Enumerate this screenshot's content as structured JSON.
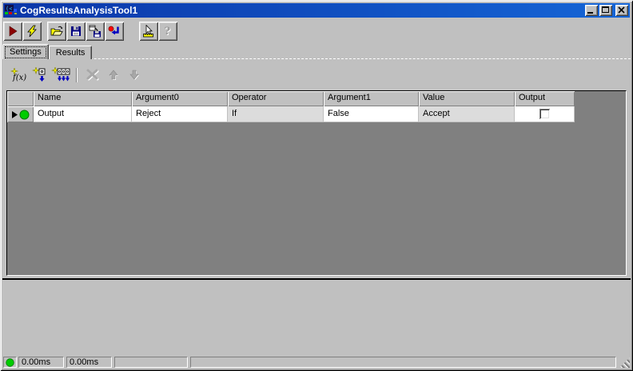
{
  "titlebar": {
    "title": "CogResultsAnalysisTool1",
    "icon": "cognex-tool-icon",
    "buttons": [
      {
        "name": "minimize",
        "icon": "minimize-icon"
      },
      {
        "name": "maximize",
        "icon": "maximize-icon"
      },
      {
        "name": "close",
        "icon": "close-icon"
      }
    ]
  },
  "main_toolbar": {
    "buttons": [
      {
        "name": "run",
        "icon": "run-icon"
      },
      {
        "name": "trigger",
        "icon": "lightning-icon"
      },
      {
        "name": "open",
        "icon": "open-folder-icon"
      },
      {
        "name": "save",
        "icon": "floppy-icon"
      },
      {
        "name": "save-as",
        "icon": "save-as-icon"
      },
      {
        "name": "reset",
        "icon": "reset-icon"
      },
      {
        "name": "pointer-tool",
        "icon": "pointer-ruler-icon"
      },
      {
        "name": "help",
        "icon": "help-icon",
        "disabled": true
      }
    ]
  },
  "tabs": [
    {
      "label": "Settings",
      "active": true
    },
    {
      "label": "Results",
      "active": false
    }
  ],
  "grid_toolbar": {
    "buttons": [
      {
        "name": "add-function",
        "icon": "add-function-icon",
        "text": "f(x)"
      },
      {
        "name": "add-input",
        "icon": "add-input-icon"
      },
      {
        "name": "add-all-inputs",
        "icon": "add-all-inputs-icon"
      },
      {
        "name": "delete",
        "icon": "delete-x-icon",
        "disabled": true
      },
      {
        "name": "move-up",
        "icon": "up-arrow-icon",
        "disabled": true
      },
      {
        "name": "move-down",
        "icon": "down-arrow-icon",
        "disabled": true
      }
    ]
  },
  "grid": {
    "columns": [
      "Name",
      "Argument0",
      "Operator",
      "Argument1",
      "Value",
      "Output"
    ],
    "rows": [
      {
        "name": "Output",
        "argument0": "Reject",
        "operator": "If",
        "argument1": "False",
        "value": "Accept",
        "output_checked": false,
        "row_status_icon": "green-circle-icon",
        "selected": true
      }
    ]
  },
  "status_bar": {
    "status_icon": "green-circle-icon",
    "time1": "0.00ms",
    "time2": "0.00ms",
    "panel4": "",
    "panel5": ""
  },
  "colors": {
    "titlebar_left": "#0b36a8",
    "titlebar_right": "#1565d6",
    "status_green": "#00cc00",
    "run_maroon": "#8b0000",
    "grid_empty": "#808080",
    "readonly_cell": "#dcdcdc"
  }
}
